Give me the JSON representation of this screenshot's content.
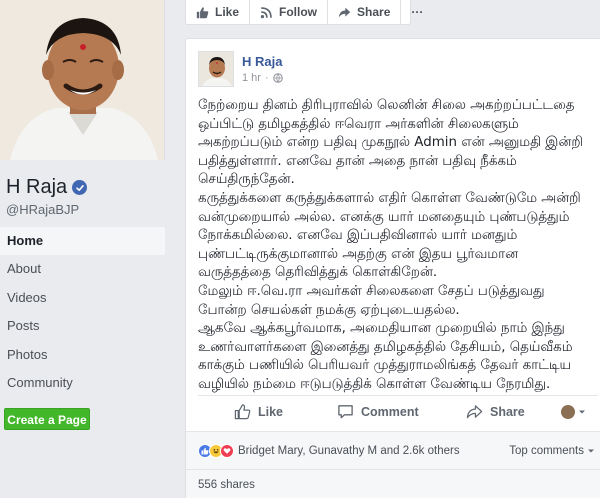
{
  "profile": {
    "name": "H Raja",
    "handle": "@HRajaBJP"
  },
  "nav": {
    "items": [
      "Home",
      "About",
      "Videos",
      "Posts",
      "Photos",
      "Community"
    ],
    "active": "Home",
    "create_page_label": "Create a Page"
  },
  "top_actions": {
    "like_label": "Like",
    "follow_label": "Follow",
    "share_label": "Share",
    "more_label": "···"
  },
  "post": {
    "author": "H Raja",
    "time": "1 hr",
    "separator": "·",
    "paragraphs": [
      "நேற்றைய தினம் திரிபுராவில் லெனின் சிலை அகற்றப்பட்டதை ஒப்பிட்டு தமிழகத்தில் ஈவெரா அர்களின் சிலைகளும் அகற்றப்படும் என்ற பதிவு முகநூல் Admin என் அனுமதி இன்றி பதித்துள்ளார். எனவே தான் அதை நான் பதிவு நீக்கம் செய்திருந்தேன்.",
      "கருத்துக்களை கருத்துக்களால் எதிர் கொள்ள வேண்டுமே அன்றி வன்முறையால் அல்ல. எனக்கு யார் மனதையும் புண்படுத்தும் நோக்கமில்லை. எனவே இப்பதிவினால் யார் மனதும் புண்பட்டிருக்குமானால் அதற்கு என் இதய பூர்வமான வருத்தத்தை தெரிவித்துக் கொள்கிறேன்.",
      "மேலும் ஈ.வெ.ரா அவர்கள் சிலைகளை சேதப் படுத்துவது போன்ற செயல்கள் நமக்கு ஏற்புடையதல்ல.",
      "ஆகவே ஆக்கபூர்வமாக, அமைதியான முறையில் நாம் இந்து உணர்வாளர்களை இனைத்து தமிழகத்தில் தேசியம், தெய்வீகம் காக்கும் பணியில் பெரியவர் முத்துராமலிங்கத் தேவர் காட்டிய வழியில் நம்மை ஈடுபடுத்திக் கொள்ள வேண்டிய நேரமிது."
    ],
    "actions": {
      "like_label": "Like",
      "comment_label": "Comment",
      "share_label": "Share"
    },
    "reactions": {
      "names": "Bridget Mary, Gunavathy M and 2.6k others",
      "sort_label": "Top comments"
    },
    "shares": "556 shares"
  },
  "colors": {
    "accent": "#4267b2",
    "link": "#385898",
    "create_page_green": "#42b72a"
  },
  "icons": [
    "thumbs-up-icon",
    "rss-icon",
    "share-arrow-icon",
    "verified-icon",
    "globe-icon",
    "comment-icon",
    "caret-down-icon"
  ]
}
